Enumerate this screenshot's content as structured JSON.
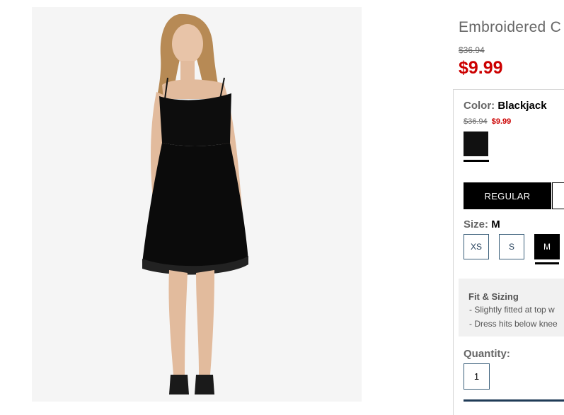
{
  "product": {
    "title": "Embroidered C",
    "original_price": "$36.94",
    "sale_price": "$9.99"
  },
  "color": {
    "label": "Color:",
    "value": "Blackjack",
    "swatch_original_price": "$36.94",
    "swatch_sale_price": "$9.99",
    "swatch_color": "#111111"
  },
  "fit_tabs": {
    "active_label": "REGULAR"
  },
  "size": {
    "label": "Size:",
    "value": "M",
    "options": [
      "XS",
      "S",
      "M"
    ],
    "selected": "M"
  },
  "fit_sizing": {
    "heading": "Fit & Sizing",
    "lines": [
      "- Slightly fitted at top w",
      "- Dress hits below knee"
    ]
  },
  "quantity": {
    "label": "Quantity:",
    "value": "1"
  },
  "colors": {
    "sale_red": "#cc0000",
    "accent_navy": "#1f3b57"
  }
}
